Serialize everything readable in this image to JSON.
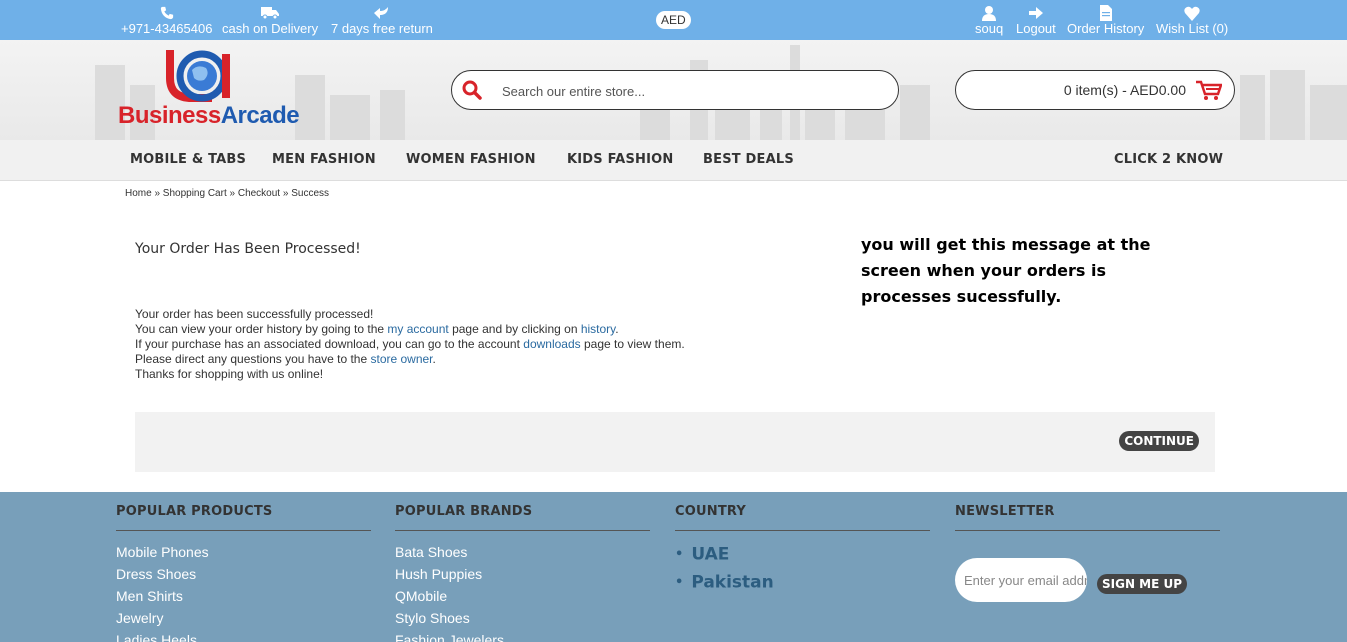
{
  "topbar": {
    "phone": "+971-43465406",
    "delivery": "cash on Delivery",
    "returns": "7 days free return",
    "currency": "AED",
    "user": "souq",
    "logout": "Logout",
    "order_history": "Order History",
    "wishlist": "Wish List (0)"
  },
  "header": {
    "logo_text_1": "Business",
    "logo_text_2": "Arcade",
    "search_placeholder": "Search our entire store...",
    "cart_text": "0 item(s) - AED0.00"
  },
  "nav": {
    "items": [
      "MOBILE & TABS",
      "MEN FASHION",
      "WOMEN FASHION",
      "KIDS FASHION",
      "BEST DEALS"
    ],
    "right": "CLICK 2 KNOW"
  },
  "breadcrumb": "Home » Shopping Cart » Checkout » Success",
  "content": {
    "title": "Your Order Has Been Processed!",
    "note": "you will get this message at the screen when your orders is processes sucessfully.",
    "line1": "Your order has been successfully processed!",
    "line2_a": "You can view your order history by going to the ",
    "line2_link1": "my account",
    "line2_b": " page and by clicking on ",
    "line2_link2": "history",
    "line2_c": ".",
    "line3_a": "If your purchase has an associated download, you can go to the account ",
    "line3_link": "downloads",
    "line3_b": " page to view them.",
    "line4_a": "Please direct any questions you have to the ",
    "line4_link": "store owner",
    "line4_b": ".",
    "line5": "Thanks for shopping with us online!",
    "continue": "CONTINUE"
  },
  "footer": {
    "popular_products": {
      "title": "POPULAR PRODUCTS",
      "items": [
        "Mobile Phones",
        "Dress Shoes",
        "Men Shirts",
        "Jewelry",
        "Ladies Heels"
      ]
    },
    "popular_brands": {
      "title": "POPULAR BRANDS",
      "items": [
        "Bata Shoes",
        "Hush Puppies",
        "QMobile",
        "Stylo Shoes",
        "Fashion Jewelers"
      ]
    },
    "country": {
      "title": "COUNTRY",
      "items": [
        "UAE",
        "Pakistan"
      ]
    },
    "newsletter": {
      "title": "NEWSLETTER",
      "placeholder": "Enter your email address",
      "button": "SIGN ME UP"
    }
  },
  "colors": {
    "topbar": "#6fb0e8",
    "footer": "#789fba",
    "accent_red": "#d8232a",
    "link": "#2a6aa0"
  }
}
